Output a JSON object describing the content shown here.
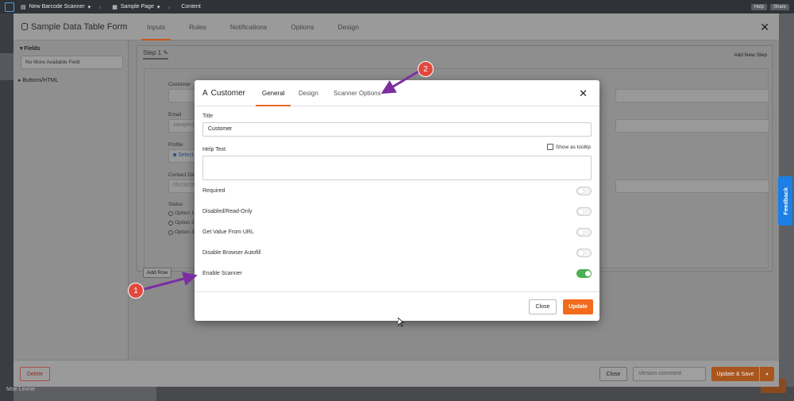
{
  "topbar": {
    "app": "New Barcode Scanner",
    "page": "Sample Page",
    "section": "Content",
    "help_label": "Help",
    "share_label": "Share"
  },
  "sidebar_user": "Moe Levine",
  "form_dialog": {
    "title": "Sample Data Table Form",
    "tabs": [
      "Inputs",
      "Rules",
      "Notifications",
      "Options",
      "Design"
    ],
    "active_tab": "Inputs",
    "fields_header": "Fields",
    "no_more_field": "No More Available Field",
    "buttons_html": "Buttons/HTML",
    "step_label": "Step 1",
    "add_new_step": "Add New Step",
    "form_fields": {
      "customer_label": "Customer",
      "email_label": "Email",
      "email_placeholder": "sample@exa",
      "profile_label": "Profile",
      "select_image": "Select Ima",
      "contact_date_label": "Contact Date",
      "contact_date_value": "05/29/2020",
      "status_label": "Status",
      "options": [
        "Option 1",
        "Option 2",
        "Option 3"
      ]
    },
    "add_row": "Add Row",
    "footer": {
      "delete": "Delete",
      "close": "Close",
      "version_placeholder": "Version comment",
      "update_save": "Update & Save"
    }
  },
  "feedback_label": "Feedback",
  "modal": {
    "title": "Customer",
    "tabs": [
      "General",
      "Design",
      "Scanner Options"
    ],
    "active_tab": "General",
    "title_label": "Title",
    "title_value": "Customer",
    "help_text_label": "Help Text",
    "show_tooltip_label": "Show as tooltip",
    "toggles": [
      {
        "label": "Required",
        "on": false
      },
      {
        "label": "Disabled/Read-Only",
        "on": false
      },
      {
        "label": "Get Value From URL",
        "on": false
      },
      {
        "label": "Disable Browser Autofill",
        "on": false
      },
      {
        "label": "Enable Scanner",
        "on": true
      }
    ],
    "close_label": "Close",
    "update_label": "Update"
  },
  "annotations": {
    "badge1": "1",
    "badge2": "2",
    "arrow_color": "#7b2fa0",
    "badge_color": "#e2483d"
  },
  "colors": {
    "accent": "#f26b1d",
    "toggle_on": "#4caf50",
    "feedback": "#1b7fe3"
  }
}
